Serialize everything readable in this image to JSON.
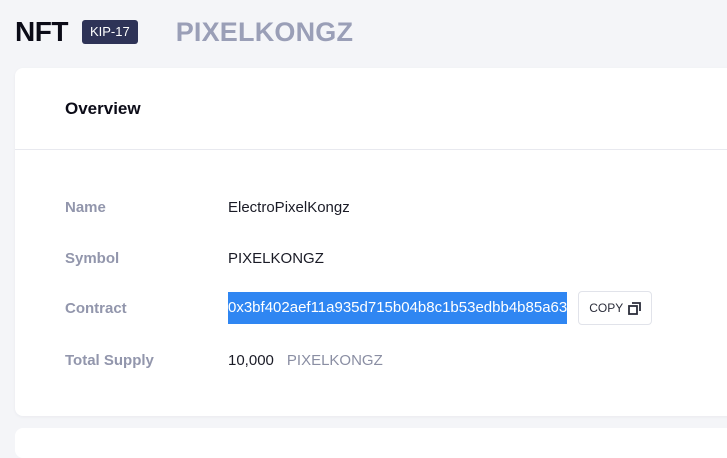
{
  "header": {
    "title": "NFT",
    "badge": "KIP-17",
    "collection_name": "PIXELKONGZ"
  },
  "overview": {
    "title": "Overview",
    "rows": {
      "name": {
        "label": "Name",
        "value": "ElectroPixelKongz"
      },
      "symbol": {
        "label": "Symbol",
        "value": "PIXELKONGZ"
      },
      "contract": {
        "label": "Contract",
        "value": "0x3bf402aef11a935d715b04b8c1b53edbb4b85a63",
        "copy_label": "COPY"
      },
      "total_supply": {
        "label": "Total Supply",
        "value": "10,000",
        "unit": "PIXELKONGZ"
      }
    }
  },
  "icons": {
    "copy": "copy-icon"
  },
  "colors": {
    "badge_background": "#2e3357",
    "selection_highlight": "#2f86f2",
    "muted_text": "#9a9fb7"
  }
}
